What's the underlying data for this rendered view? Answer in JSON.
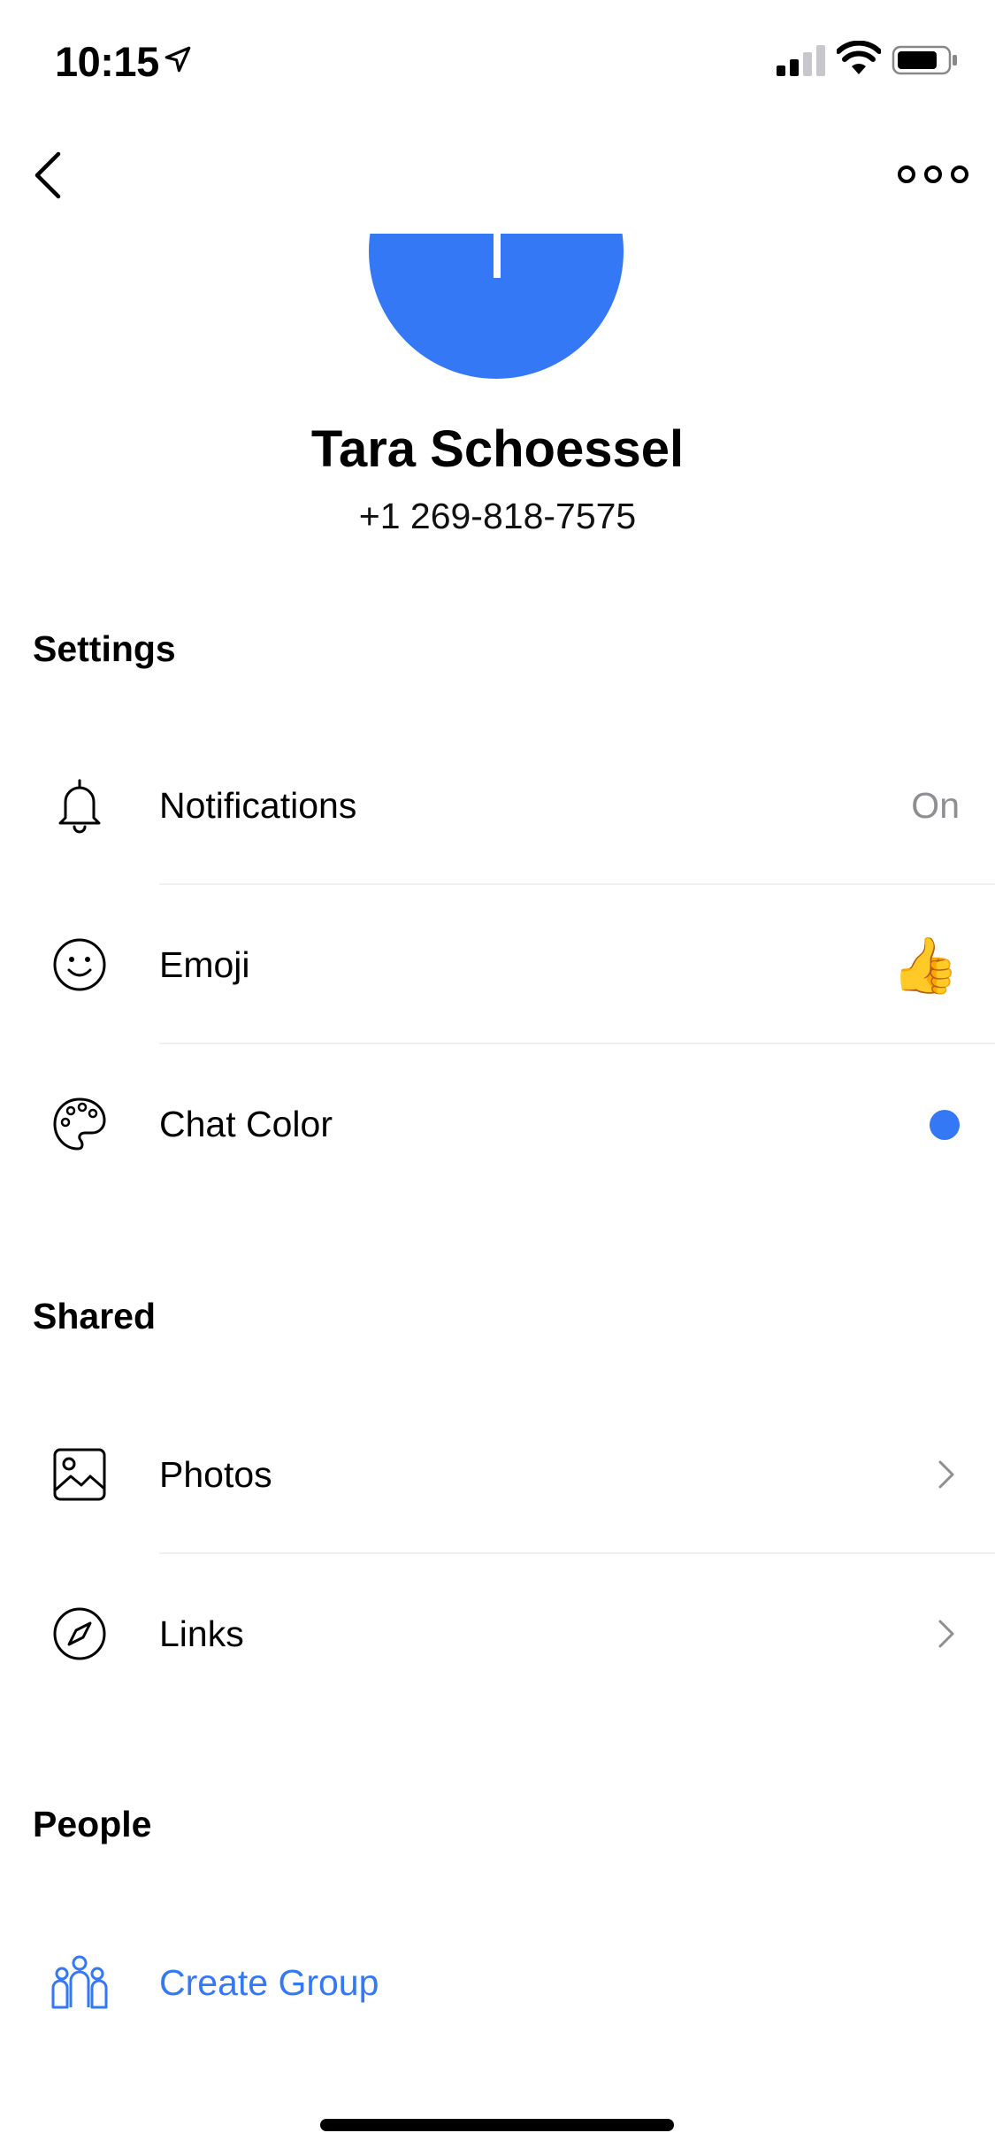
{
  "status_bar": {
    "time": "10:15",
    "icons": [
      "location-arrow-icon",
      "cellular-signal-icon",
      "wifi-icon",
      "battery-icon"
    ]
  },
  "nav": {
    "back_icon": "chevron-left-icon",
    "more_icon": "more-horizontal-icon"
  },
  "contact": {
    "name": "Tara Schoessel",
    "phone": "+1 269-818-7575",
    "avatar_color": "#3478f6"
  },
  "sections": {
    "settings": {
      "title": "Settings",
      "items": [
        {
          "label": "Notifications",
          "value": "On",
          "icon": "bell-icon"
        },
        {
          "label": "Emoji",
          "value": "👍",
          "icon": "smiley-icon"
        },
        {
          "label": "Chat Color",
          "icon": "palette-icon",
          "color": "#3478f6"
        }
      ]
    },
    "shared": {
      "title": "Shared",
      "items": [
        {
          "label": "Photos",
          "icon": "photo-icon"
        },
        {
          "label": "Links",
          "icon": "compass-icon"
        }
      ]
    },
    "people": {
      "title": "People",
      "items": [
        {
          "label": "Create Group",
          "icon": "group-icon"
        }
      ]
    }
  },
  "colors": {
    "accent": "#3478f6",
    "secondary_text": "#8e8e93"
  }
}
